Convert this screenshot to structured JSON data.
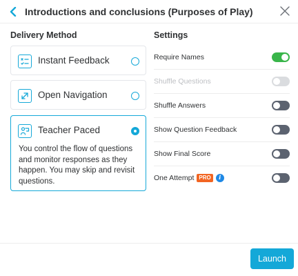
{
  "header": {
    "title": "Introductions and conclusions (Purposes of Play)",
    "back_icon": "chevron-left-icon",
    "close_icon": "close-icon"
  },
  "delivery": {
    "heading": "Delivery Method",
    "options": [
      {
        "label": "Instant Feedback",
        "icon": "instant-feedback-icon",
        "selected": false
      },
      {
        "label": "Open Navigation",
        "icon": "open-navigation-icon",
        "selected": false
      },
      {
        "label": "Teacher Paced",
        "icon": "teacher-paced-icon",
        "selected": true,
        "description": "You control the flow of questions and monitor responses as they happen. You may skip and revisit questions."
      }
    ]
  },
  "settings": {
    "heading": "Settings",
    "items": [
      {
        "label": "Require Names",
        "enabled": true,
        "disabled": false
      },
      {
        "label": "Shuffle Questions",
        "enabled": false,
        "disabled": true
      },
      {
        "label": "Shuffle Answers",
        "enabled": false,
        "disabled": false
      },
      {
        "label": "Show Question Feedback",
        "enabled": false,
        "disabled": false
      },
      {
        "label": "Show Final Score",
        "enabled": false,
        "disabled": false
      },
      {
        "label": "One Attempt",
        "enabled": false,
        "disabled": false,
        "badge": "PRO",
        "info_icon": "info-icon"
      }
    ]
  },
  "footer": {
    "launch_label": "Launch"
  },
  "colors": {
    "accent": "#14a8d8",
    "toggle_on": "#39b54a",
    "toggle_off": "#5c6370",
    "pro_badge": "#f26522",
    "info": "#1e88e5"
  }
}
